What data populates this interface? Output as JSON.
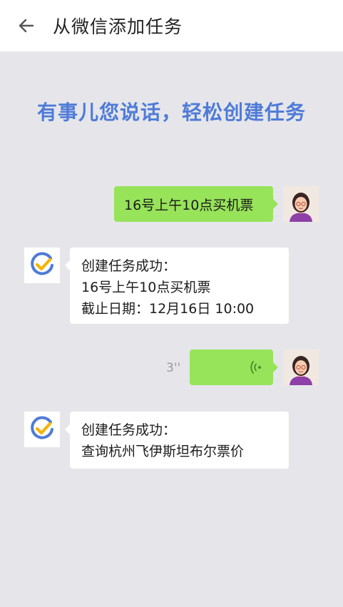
{
  "header": {
    "title": "从微信添加任务"
  },
  "tagline": "有事儿您说话，轻松创建任务",
  "chat": {
    "user_message_1": "16号上午10点买机票",
    "bot_reply_1": {
      "line1": "创建任务成功：",
      "line2": "16号上午10点买机票",
      "line3": "截止日期：12月16日 10:00"
    },
    "voice_message": {
      "duration": "3''"
    },
    "bot_reply_2": {
      "line1": "创建任务成功：",
      "line2": "查询杭州飞伊斯坦布尔票价"
    }
  },
  "colors": {
    "accent": "#4f7bd8",
    "user_bubble": "#97e35a",
    "bot_bubble": "#ffffff",
    "background": "#e6e6ea"
  },
  "icons": [
    "back-arrow-icon",
    "user-avatar",
    "ticktick-logo-icon",
    "voice-wave-icon"
  ]
}
